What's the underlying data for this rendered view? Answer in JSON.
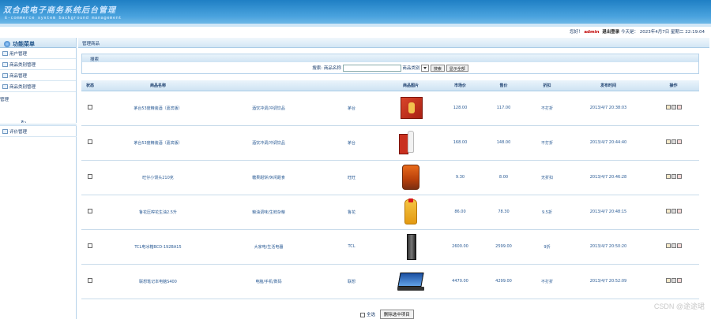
{
  "header": {
    "title": "双合成电子商务系统后台管理",
    "subtitle": "E-commerce system background management"
  },
  "userbar": {
    "greeting": "您好！",
    "user": "admin",
    "logout": "退出登录",
    "today_label": "今天是：",
    "date": "2023年4月7日 星期二  22:19:04"
  },
  "sidebar": {
    "title": "功能菜单",
    "items": [
      {
        "label": "用户管理"
      },
      {
        "label": "商品类别管理"
      },
      {
        "label": "商品管理"
      },
      {
        "label": "商品类别管理"
      }
    ],
    "extra_label": "管理",
    "review_label": "评价管理"
  },
  "breadcrumb": "管理商品",
  "search": {
    "title": "搜索",
    "name_label": "搜索: 商品名称",
    "category_label": "商品类别",
    "search_btn": "搜索",
    "show_all_btn": "显示全部"
  },
  "table": {
    "headers": [
      "状态",
      "商品名称",
      "",
      "",
      "商品图片",
      "市场价",
      "售价",
      "折扣",
      "发布时间",
      "操作"
    ],
    "rows": [
      {
        "name": "茅台53度精装酒（嘉宾版）",
        "category": "酒饮冲调/冲调饮品",
        "brand": "茅台",
        "market": "128.00",
        "price": "117.00",
        "discount": "不打折",
        "time": "2013/4/7 20:38:03",
        "img": "box-red"
      },
      {
        "name": "茅台53度精装酒（嘉宾版）",
        "category": "酒饮冲调/冲调饮品",
        "brand": "茅台",
        "market": "168.00",
        "price": "148.00",
        "discount": "不打折",
        "time": "2013/4/7 20:44:40",
        "img": "bottle"
      },
      {
        "name": "旺仔小馒头210克",
        "category": "糖果甜饼/休闲甜食",
        "brand": "旺旺",
        "market": "9.30",
        "price": "8.00",
        "discount": "无折扣",
        "time": "2013/4/7 20:46:28",
        "img": "snack"
      },
      {
        "name": "鲁花压榨花生油2.5升",
        "category": "粮油调味/生鲜杂粮",
        "brand": "鲁花",
        "market": "86.00",
        "price": "78.30",
        "discount": "9.5折",
        "time": "2013/4/7 20:48:15",
        "img": "oil"
      },
      {
        "name": "TCL电冰箱BCD-192BA15",
        "category": "大家电/生活电器",
        "brand": "TCL",
        "market": "2600.00",
        "price": "2599.00",
        "discount": "9折",
        "time": "2013/4/7 20:50:20",
        "img": "fridge"
      },
      {
        "name": "联想笔记本电脑S400",
        "category": "电脑/手机/数码",
        "brand": "联想",
        "market": "4470.00",
        "price": "4299.00",
        "discount": "不打折",
        "time": "2013/4/7 20:52:09",
        "img": "laptop"
      }
    ]
  },
  "footer": {
    "select_all": "全选",
    "delete_btn": "删除选中项目"
  },
  "watermark": "CSDN @途途珺"
}
